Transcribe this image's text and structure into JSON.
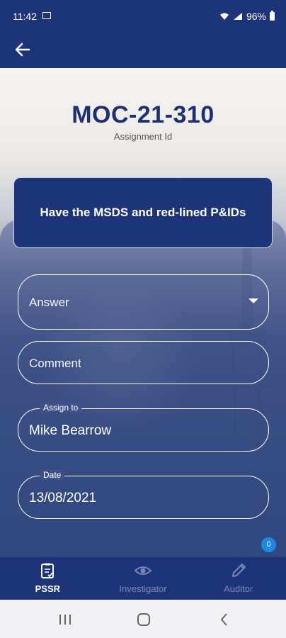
{
  "status_bar": {
    "time": "11:42",
    "battery": "96%",
    "icons": [
      "image-icon",
      "wifi-icon",
      "signal-icon",
      "battery-icon"
    ]
  },
  "app_bar": {
    "back_icon": "arrow-left-icon"
  },
  "assignment": {
    "id": "MOC-21-310",
    "label": "Assignment Id"
  },
  "question": {
    "text": "Have the MSDS and red-lined P&IDs"
  },
  "form": {
    "answer": {
      "placeholder": "Answer",
      "icon": "dropdown-arrow-icon"
    },
    "comment": {
      "placeholder": "Comment"
    },
    "assign_to": {
      "label": "Assign to",
      "value": "Mike Bearrow"
    },
    "date": {
      "label": "Date",
      "value": "13/08/2021"
    }
  },
  "badge": {
    "count": "0"
  },
  "bottom_nav": {
    "items": [
      {
        "label": "PSSR",
        "icon": "clipboard-check-icon",
        "active": true
      },
      {
        "label": "Investigator",
        "icon": "eye-icon",
        "active": false
      },
      {
        "label": "Auditor",
        "icon": "pencil-icon",
        "active": false
      }
    ]
  },
  "system_nav": {
    "items": [
      "recents-icon",
      "home-icon",
      "back-icon"
    ]
  },
  "colors": {
    "primary": "#1e3478",
    "title": "#1e2f78",
    "badge": "#1e88e5"
  }
}
